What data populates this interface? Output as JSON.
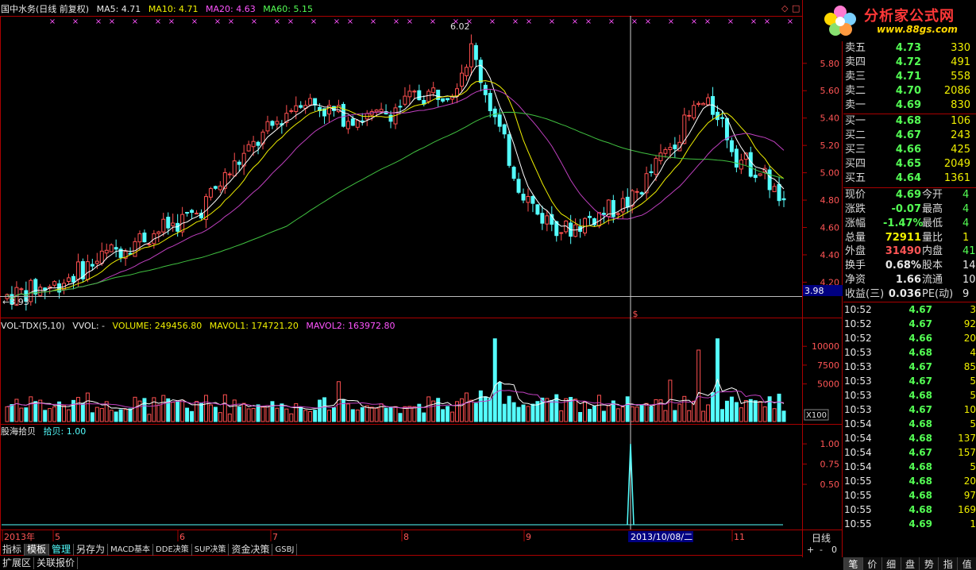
{
  "header": {
    "stock_title": "国中水务(日线 前复权)",
    "ma5": "MA5: 4.71",
    "ma10": "MA10: 4.71",
    "ma20": "MA20: 4.63",
    "ma60": "MA60: 5.15"
  },
  "vol_legend": {
    "name": "VOL-TDX(5,10)",
    "vvol": "VVOL: -",
    "volume": "VOLUME: 249456.80",
    "mavol1": "MAVOL1: 174721.20",
    "mavol2": "MAVOL2: 163972.80"
  },
  "ind_legend": {
    "name": "股海拾贝",
    "value": "拾贝: 1.00"
  },
  "chart_data": [
    {
      "type": "candlestick",
      "panel": "price",
      "y_ticks": [
        "5.80",
        "5.60",
        "5.40",
        "5.20",
        "5.00",
        "4.80",
        "4.60",
        "4.40",
        "4.20"
      ],
      "ylim": [
        4.04,
        6.06
      ],
      "high_label": "6.02",
      "low_label": "3.93",
      "cursor_price": "3.98",
      "series": [
        {
          "name": "MA5",
          "color": "#ffffff"
        },
        {
          "name": "MA10",
          "color": "#f0f000"
        },
        {
          "name": "MA20",
          "color": "#c040c0"
        },
        {
          "name": "MA60",
          "color": "#40c040"
        }
      ],
      "colors": {
        "up": "#ff5050",
        "down": "#54ffff"
      }
    },
    {
      "type": "bar",
      "panel": "volume",
      "y_ticks": [
        "10000",
        "7500",
        "5000"
      ],
      "ylim": [
        0,
        11500
      ],
      "unit": "X100"
    },
    {
      "type": "line",
      "panel": "indicator",
      "y_ticks": [
        "1.00",
        "0.75",
        "0.50"
      ],
      "ylim": [
        0,
        1.05
      ],
      "signal_at_cursor": 1.0
    }
  ],
  "x_axis": {
    "labels": [
      "2013年",
      "5",
      "6",
      "7",
      "8",
      "9",
      "11"
    ],
    "cursor_date": "2013/10/08/二",
    "period": "日线"
  },
  "quote": {
    "asks": [
      {
        "label": "卖五",
        "price": "4.73",
        "vol": "330",
        "color": "#54ff54"
      },
      {
        "label": "卖四",
        "price": "4.72",
        "vol": "491",
        "color": "#54ff54"
      },
      {
        "label": "卖三",
        "price": "4.71",
        "vol": "558",
        "color": "#54ff54"
      },
      {
        "label": "卖二",
        "price": "4.70",
        "vol": "2086",
        "color": "#54ff54"
      },
      {
        "label": "卖一",
        "price": "4.69",
        "vol": "830",
        "color": "#54ff54"
      }
    ],
    "bids": [
      {
        "label": "买一",
        "price": "4.68",
        "vol": "106",
        "color": "#54ff54"
      },
      {
        "label": "买二",
        "price": "4.67",
        "vol": "243",
        "color": "#54ff54"
      },
      {
        "label": "买三",
        "price": "4.66",
        "vol": "425",
        "color": "#54ff54"
      },
      {
        "label": "买四",
        "price": "4.65",
        "vol": "2049",
        "color": "#54ff54"
      },
      {
        "label": "买五",
        "price": "4.64",
        "vol": "1361",
        "color": "#54ff54"
      }
    ],
    "stats": [
      {
        "l1": "现价",
        "v1": "4.69",
        "c1": "#54ff54",
        "l2": "今开",
        "v2": "4",
        "c2": "#54ff54"
      },
      {
        "l1": "涨跌",
        "v1": "-0.07",
        "c1": "#54ff54",
        "l2": "最高",
        "v2": "4",
        "c2": "#54ff54"
      },
      {
        "l1": "涨幅",
        "v1": "-1.47%",
        "c1": "#54ff54",
        "l2": "最低",
        "v2": "4",
        "c2": "#54ff54"
      },
      {
        "l1": "总量",
        "v1": "72911",
        "c1": "#f0f000",
        "l2": "量比",
        "v2": "1",
        "c2": "#f0f000"
      },
      {
        "l1": "外盘",
        "v1": "31490",
        "c1": "#ff5555",
        "l2": "内盘",
        "v2": "41",
        "c2": "#54ff54"
      },
      {
        "l1": "换手",
        "v1": "0.68%",
        "c1": "#e8e8e8",
        "l2": "股本",
        "v2": "14",
        "c2": "#e8e8e8"
      },
      {
        "l1": "净资",
        "v1": "1.66",
        "c1": "#e8e8e8",
        "l2": "流通",
        "v2": "10",
        "c2": "#e8e8e8"
      },
      {
        "l1": "收益(三)",
        "v1": "0.036",
        "c1": "#e8e8e8",
        "l2": "PE(动)",
        "v2": "9",
        "c2": "#e8e8e8"
      }
    ],
    "ticks": [
      {
        "time": "10:52",
        "price": "4.67",
        "vol": "3"
      },
      {
        "time": "10:52",
        "price": "4.67",
        "vol": "92"
      },
      {
        "time": "10:52",
        "price": "4.66",
        "vol": "20"
      },
      {
        "time": "10:53",
        "price": "4.68",
        "vol": "4"
      },
      {
        "time": "10:53",
        "price": "4.67",
        "vol": "85"
      },
      {
        "time": "10:53",
        "price": "4.67",
        "vol": "5"
      },
      {
        "time": "10:53",
        "price": "4.68",
        "vol": "5"
      },
      {
        "time": "10:53",
        "price": "4.67",
        "vol": "10"
      },
      {
        "time": "10:54",
        "price": "4.68",
        "vol": "5"
      },
      {
        "time": "10:54",
        "price": "4.68",
        "vol": "137"
      },
      {
        "time": "10:54",
        "price": "4.67",
        "vol": "157"
      },
      {
        "time": "10:54",
        "price": "4.68",
        "vol": "5"
      },
      {
        "time": "10:55",
        "price": "4.68",
        "vol": "20"
      },
      {
        "time": "10:55",
        "price": "4.68",
        "vol": "97"
      },
      {
        "time": "10:55",
        "price": "4.68",
        "vol": "169"
      },
      {
        "time": "10:55",
        "price": "4.69",
        "vol": "1"
      }
    ]
  },
  "logo": {
    "brand": "分析家公式网",
    "site": "www.88gs.com"
  },
  "bottom_tabs": [
    "指标",
    "模板",
    "管理",
    "另存为",
    "MACD基本",
    "DDE决策",
    "SUP决策",
    "资金决策",
    "GSBJ"
  ],
  "bottom_bar2": [
    "扩展区",
    "关联报价"
  ],
  "right_tabs": [
    "笔",
    "价",
    "细",
    "盘",
    "势",
    "指",
    "值"
  ],
  "controls": {
    "plus": "+",
    "minus": "-",
    "zero": "0",
    "diamond": "◇",
    "square": "□"
  },
  "colors": {
    "up": "#ff5050",
    "down": "#54ffff",
    "ma5": "#ffffff",
    "ma10": "#f0f000",
    "ma20": "#c040c0",
    "ma60": "#40c040",
    "frame": "#aa0000"
  }
}
